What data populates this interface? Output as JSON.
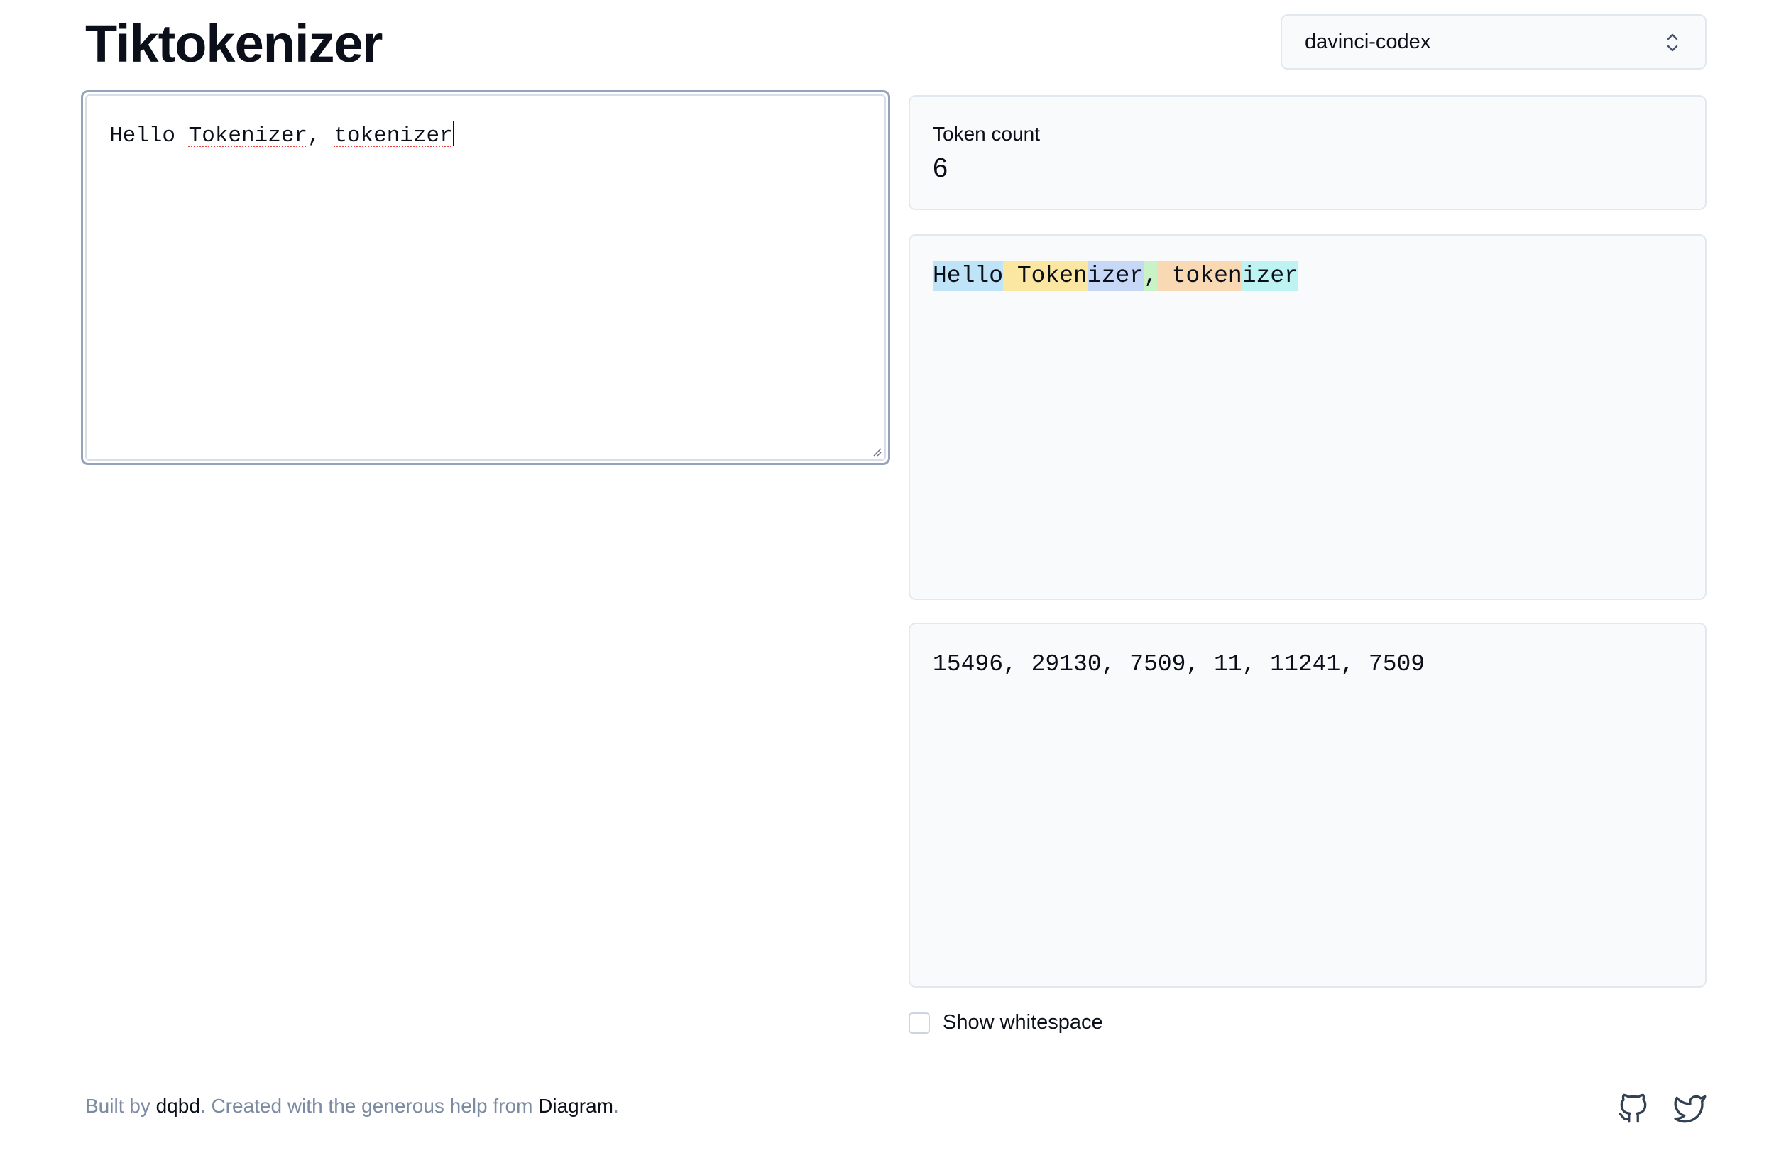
{
  "app": {
    "title": "Tiktokenizer"
  },
  "model_select": {
    "value": "davinci-codex",
    "icon": "chevron-up-down-icon"
  },
  "input": {
    "text": "Hello Tokenizer, tokenizer"
  },
  "token_count": {
    "label": "Token count",
    "value": "6"
  },
  "tokens": [
    {
      "text": "Hello",
      "color": "#bfe3f7"
    },
    {
      "text": " Token",
      "color": "#fbe7a1"
    },
    {
      "text": "izer",
      "color": "#c7d7f6"
    },
    {
      "text": ",",
      "color": "#c9f2c7"
    },
    {
      "text": " token",
      "color": "#f8d9b4"
    },
    {
      "text": "izer",
      "color": "#bdf3f3"
    }
  ],
  "token_ids": "15496, 29130, 7509, 11, 11241, 7509",
  "show_whitespace": {
    "label": "Show whitespace",
    "checked": false
  },
  "footer": {
    "built_by_prefix": "Built by",
    "author": "dqbd",
    "middle": ". Created with the generous help from",
    "partner": "Diagram",
    "suffix": "."
  },
  "social": {
    "github_icon": "github-icon",
    "twitter_icon": "twitter-icon"
  }
}
